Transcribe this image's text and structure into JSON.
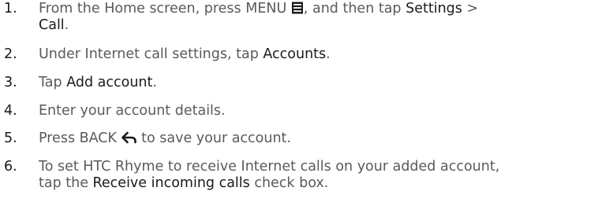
{
  "steps": [
    {
      "number": "1.",
      "t1": "From the Home screen, press MENU ",
      "icon": "menu-icon",
      "t2": ", and then tap ",
      "b1": "Settings",
      "t3": " >",
      "b2": "Call",
      "t4": "."
    },
    {
      "number": "2.",
      "t1": "Under Internet call settings, tap ",
      "b1": "Accounts",
      "t2": "."
    },
    {
      "number": "3.",
      "t1": "Tap ",
      "b1": "Add account",
      "t2": "."
    },
    {
      "number": "4.",
      "t1": "Enter your account details."
    },
    {
      "number": "5.",
      "t1": "Press BACK ",
      "icon": "back-arrow-icon",
      "t2": " to save your account."
    },
    {
      "number": "6.",
      "t1": "To set HTC Rhyme to receive Internet calls on your added account,",
      "t2": "tap the ",
      "b1": "Receive incoming calls",
      "t3": " check box."
    }
  ]
}
